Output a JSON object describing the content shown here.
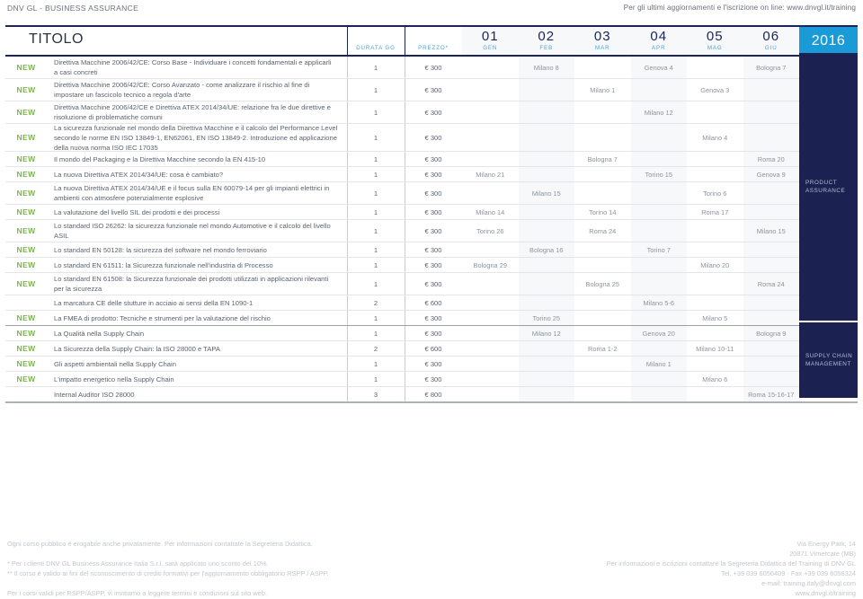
{
  "topbar": {
    "brand": "DNV GL - BUSINESS ASSURANCE",
    "updates": "Per gli ultimi aggiornamenti e l'iscrizione on line: www.dnvgl.it/training"
  },
  "header": {
    "title": "TITOLO",
    "duration_label": "DURATA GG",
    "price_label": "PREZZO*",
    "year": "2016",
    "months": [
      {
        "num": "01",
        "name": "GEN"
      },
      {
        "num": "02",
        "name": "FEB"
      },
      {
        "num": "03",
        "name": "MAR"
      },
      {
        "num": "04",
        "name": "APR"
      },
      {
        "num": "05",
        "name": "MAG"
      },
      {
        "num": "06",
        "name": "GIU"
      }
    ]
  },
  "new_badge": "NEW",
  "categories": [
    {
      "label": "PRODUCT\nASSURANCE",
      "line1": "PRODUCT",
      "line2": "ASSURANCE"
    },
    {
      "label": "SUPPLY CHAIN\nMANAGEMENT",
      "line1": "SUPPLY CHAIN",
      "line2": "MANAGEMENT"
    }
  ],
  "rows": [
    {
      "new": true,
      "title": [
        "Direttiva Macchine 2006/42/CE: Corso Base - Individuare i concetti fondamentali e applicarli",
        "a casi concreti"
      ],
      "duration": "1",
      "price": "€ 300",
      "months": [
        "",
        "Milano 8",
        "",
        "Genova 4",
        "",
        "Bologna 7"
      ]
    },
    {
      "new": true,
      "title": [
        "Direttiva Macchine 2006/42/CE: Corso Avanzato - come analizzare il rischio al fine di",
        "impostare un fascicolo tecnico a regola d'arte"
      ],
      "duration": "1",
      "price": "€ 300",
      "months": [
        "",
        "",
        "Milano 1",
        "",
        "Genova 3",
        ""
      ]
    },
    {
      "new": true,
      "title": [
        "Direttiva Macchine 2006/42/CE e Direttiva ATEX 2014/34/UE: relazione fra le due direttive e",
        "risoluzione di problematiche comuni"
      ],
      "duration": "1",
      "price": "€ 300",
      "months": [
        "",
        "",
        "",
        "Milano 12",
        "",
        ""
      ]
    },
    {
      "new": true,
      "title": [
        "La sicurezza funzionale nel mondo della Direttiva Macchine e il calcolo del Performance Level",
        "secondo le norme EN ISO 13849-1, EN62061, EN ISO 13849-2. Introduzione ed applicazione",
        "della nuova norma ISO IEC 17035"
      ],
      "duration": "1",
      "price": "€ 300",
      "months": [
        "",
        "",
        "",
        "",
        "Milano 4",
        ""
      ]
    },
    {
      "new": true,
      "title": [
        "Il mondo del Packaging e la Direttiva Macchine secondo la EN 415-10"
      ],
      "duration": "1",
      "price": "€ 300",
      "months": [
        "",
        "",
        "Bologna 7",
        "",
        "",
        "Roma 20"
      ]
    },
    {
      "new": true,
      "title": [
        "La nuova Direttiva ATEX 2014/34/UE: cosa è cambiato?"
      ],
      "duration": "1",
      "price": "€ 300",
      "months": [
        "Milano 21",
        "",
        "",
        "Torino 15",
        "",
        "Genova 9"
      ]
    },
    {
      "new": true,
      "title": [
        "La nuova Direttiva ATEX 2014/34/UE e il focus sulla EN 60079-14 per gli impianti elettrici in",
        "ambienti con atmosfere potenzialmente esplosive"
      ],
      "duration": "1",
      "price": "€ 300",
      "months": [
        "",
        "Milano 15",
        "",
        "",
        "Torino 6",
        ""
      ]
    },
    {
      "new": true,
      "title": [
        "La valutazione del livello SIL dei prodotti e dei processi"
      ],
      "duration": "1",
      "price": "€ 300",
      "months": [
        "Milano 14",
        "",
        "Torino 14",
        "",
        "Roma 17",
        ""
      ]
    },
    {
      "new": true,
      "title": [
        "Lo standard ISO 26262: la sicurezza funzionale nel mondo Automotive e il calcolo del livello",
        "ASIL"
      ],
      "duration": "1",
      "price": "€ 300",
      "months": [
        "Torino 26",
        "",
        "Roma 24",
        "",
        "",
        "Milano 15"
      ]
    },
    {
      "new": true,
      "title": [
        "Lo standard EN 50128: la sicurezza del software nel mondo ferroviario"
      ],
      "duration": "1",
      "price": "€ 300",
      "months": [
        "",
        "Bologna 16",
        "",
        "Torino 7",
        "",
        ""
      ]
    },
    {
      "new": true,
      "title": [
        "Lo standard EN 61511: la Sicurezza funzionale nell'industria di Processo"
      ],
      "duration": "1",
      "price": "€ 300",
      "months": [
        "Bologna 29",
        "",
        "",
        "",
        "Milano 20",
        ""
      ]
    },
    {
      "new": true,
      "title": [
        "Lo standard EN 61508: la Sicurezza funzionale dei prodotti utilizzati in applicazioni rilevanti",
        "per la sicurezza"
      ],
      "duration": "1",
      "price": "€ 300",
      "months": [
        "",
        "",
        "Bologna 25",
        "",
        "",
        "Roma 24"
      ]
    },
    {
      "new": false,
      "title": [
        "La marcatura CE delle stutture in acciaio ai sensi della EN 1090-1"
      ],
      "duration": "2",
      "price": "€ 600",
      "months": [
        "",
        "",
        "",
        "Milano 5-6",
        "",
        ""
      ]
    },
    {
      "new": true,
      "title": [
        "La FMEA di prodotto: Tecniche e strumenti per la valutazione del rischio"
      ],
      "duration": "1",
      "price": "€ 300",
      "months": [
        "",
        "Torino 25",
        "",
        "",
        "Milano 5",
        ""
      ],
      "section_end": true
    },
    {
      "new": true,
      "title": [
        "La Qualità nella Supply Chain"
      ],
      "duration": "1",
      "price": "€ 300",
      "months": [
        "",
        "Milano 12",
        "",
        "Genova 20",
        "",
        "Bologna 9"
      ]
    },
    {
      "new": true,
      "title": [
        "La Sicurezza della Supply Chain: la ISO 28000 e TAPA"
      ],
      "duration": "2",
      "price": "€ 600",
      "months": [
        "",
        "",
        "Roma 1-2",
        "",
        "Milano 10-11",
        ""
      ]
    },
    {
      "new": true,
      "title": [
        "Gli aspetti ambientali nella Supply Chain"
      ],
      "duration": "1",
      "price": "€ 300",
      "months": [
        "",
        "",
        "",
        "Milano 1",
        "",
        ""
      ]
    },
    {
      "new": true,
      "title": [
        "L'impatto energetico nella Supply Chain"
      ],
      "duration": "1",
      "price": "€ 300",
      "months": [
        "",
        "",
        "",
        "",
        "Milano 6",
        ""
      ]
    },
    {
      "new": false,
      "title": [
        "Internal Auditor ISO 28000"
      ],
      "duration": "3",
      "price": "€ 800",
      "months": [
        "",
        "",
        "",
        "",
        "",
        "Roma 15-16-17"
      ],
      "last": true
    }
  ],
  "footer": {
    "left": [
      "Ogni corso pubblico è erogabile anche privatamente. Per informazioni contattate la Segreteria Didattica.",
      "* Per i clienti DNV GL Business Assurance Italia S.r.l. sarà applicato uno sconto del 10%.",
      "** Il corso è valido ai fini del riconoscimento di crediti formativi per l'aggiornamento obbligatorio RSPP / ASPP.",
      "Per i corsi validi per RSPP/ASPP, vi invitiamo a leggere termini e condizioni sul sito web."
    ],
    "right": [
      "Via Energy Park, 14",
      "20871 Vimercate (MB)",
      "Per informazioni e iscrizioni contattare la Segreteria Didattica del Training di DNV GL",
      "Tel. +39 039 6056409 - Fax +39 039 6058324",
      "e-mail: training.italy@dnvgl.com",
      "www.dnvgl.it/training"
    ]
  },
  "colors": {
    "navy": "#1b2150",
    "cyan": "#1a9ad7",
    "green": "#7ab648",
    "text": "#5b636f"
  }
}
